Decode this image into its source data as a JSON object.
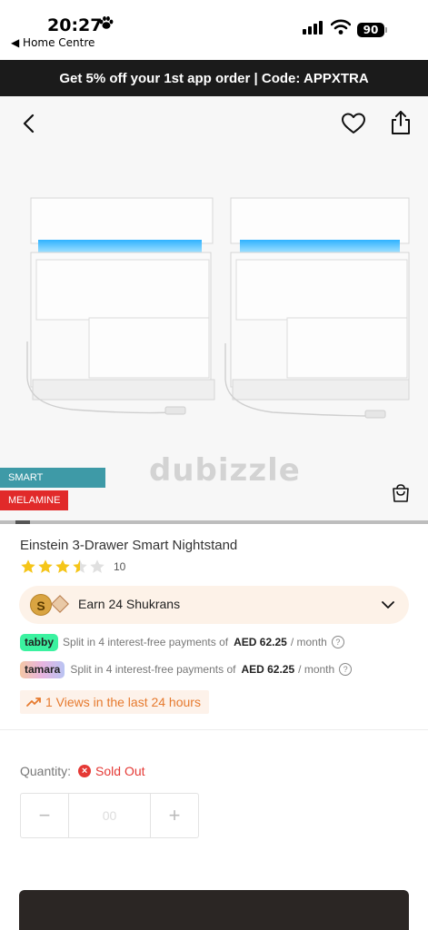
{
  "status_bar": {
    "time": "20:27",
    "back_app": "◀ Home Centre",
    "battery": "90"
  },
  "promo": {
    "text": "Get 5% off your 1st app order | Code: APPXTRA"
  },
  "gallery": {
    "watermark": "dubizzle",
    "tags": [
      "SMART FURNITURE",
      "MELAMINE"
    ],
    "icons": [
      "back-icon",
      "heart-icon",
      "share-icon",
      "cart-icon"
    ],
    "progress_fraction": 0.035
  },
  "product": {
    "title": "Einstein 3-Drawer Smart Nightstand",
    "rating": 3.5,
    "review_count": "10"
  },
  "shukran": {
    "coin_letter": "S",
    "label": "Earn 24 Shukrans"
  },
  "payments": {
    "tabby": {
      "logo": "tabby",
      "text": "Split in 4 interest-free payments of",
      "amount": "AED 62.25",
      "period": "/ month"
    },
    "tamara": {
      "logo": "tamara",
      "text": "Split in 4 interest-free payments of",
      "amount": "AED 62.25",
      "period": "/ month"
    }
  },
  "views": {
    "text": "1 Views in the last 24 hours"
  },
  "quantity": {
    "label": "Quantity:",
    "status": "Sold Out",
    "value": "00",
    "minus": "−",
    "plus": "+"
  },
  "colors": {
    "promo_bg": "#1b1b1b",
    "tag_furniture": "#3e9aa7",
    "tag_melamine": "#e12a2a",
    "sold_out": "#e53935",
    "views": "#e67a2e",
    "star": "#f5c518"
  }
}
